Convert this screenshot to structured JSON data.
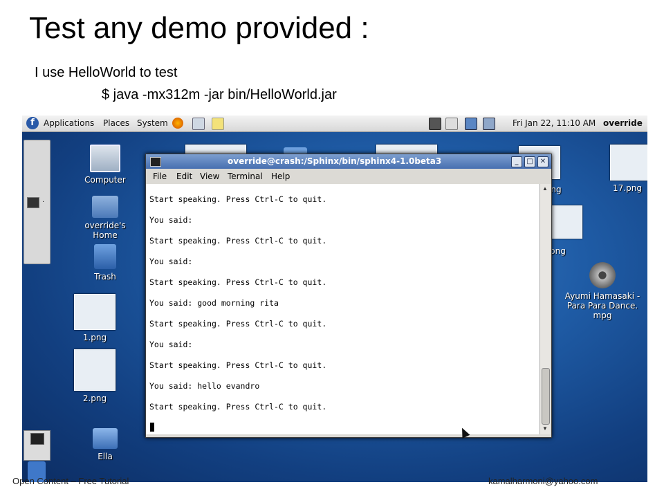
{
  "slide": {
    "title": "Test any demo provided :",
    "line1": "I use HelloWorld to test",
    "line2": "$ java -mx312m -jar bin/HelloWorld.jar",
    "footer_left": "Open Content – Free Tutorial",
    "footer_right": "kamalharmoni@yahoo.com"
  },
  "panel": {
    "menus": [
      "Applications",
      "Places",
      "System"
    ],
    "clock": "Fri Jan 22, 11:10 AM",
    "user": "override"
  },
  "desktop": {
    "icons": [
      "Computer",
      "override's Home",
      "Trash",
      "1.png",
      "2.png",
      "Ella"
    ],
    "right_icons": [
      "17.png",
      "Ayumi Hamasaki - Para Para Dance.",
      "mpg"
    ],
    "partial_labels": [
      ".png",
      "png"
    ]
  },
  "terminal": {
    "title": "override@crash:/Sphinx/bin/sphinx4-1.0beta3",
    "menu": [
      "File",
      "Edit",
      "View",
      "Terminal",
      "Help"
    ],
    "lines": [
      "Start speaking. Press Ctrl-C to quit.",
      "You said:",
      "Start speaking. Press Ctrl-C to quit.",
      "You said:",
      "Start speaking. Press Ctrl-C to quit.",
      "You said: good morning rita",
      "Start speaking. Press Ctrl-C to quit.",
      "You said:",
      "Start speaking. Press Ctrl-C to quit.",
      "You said: hello evandro",
      "Start speaking. Press Ctrl-C to quit."
    ]
  }
}
